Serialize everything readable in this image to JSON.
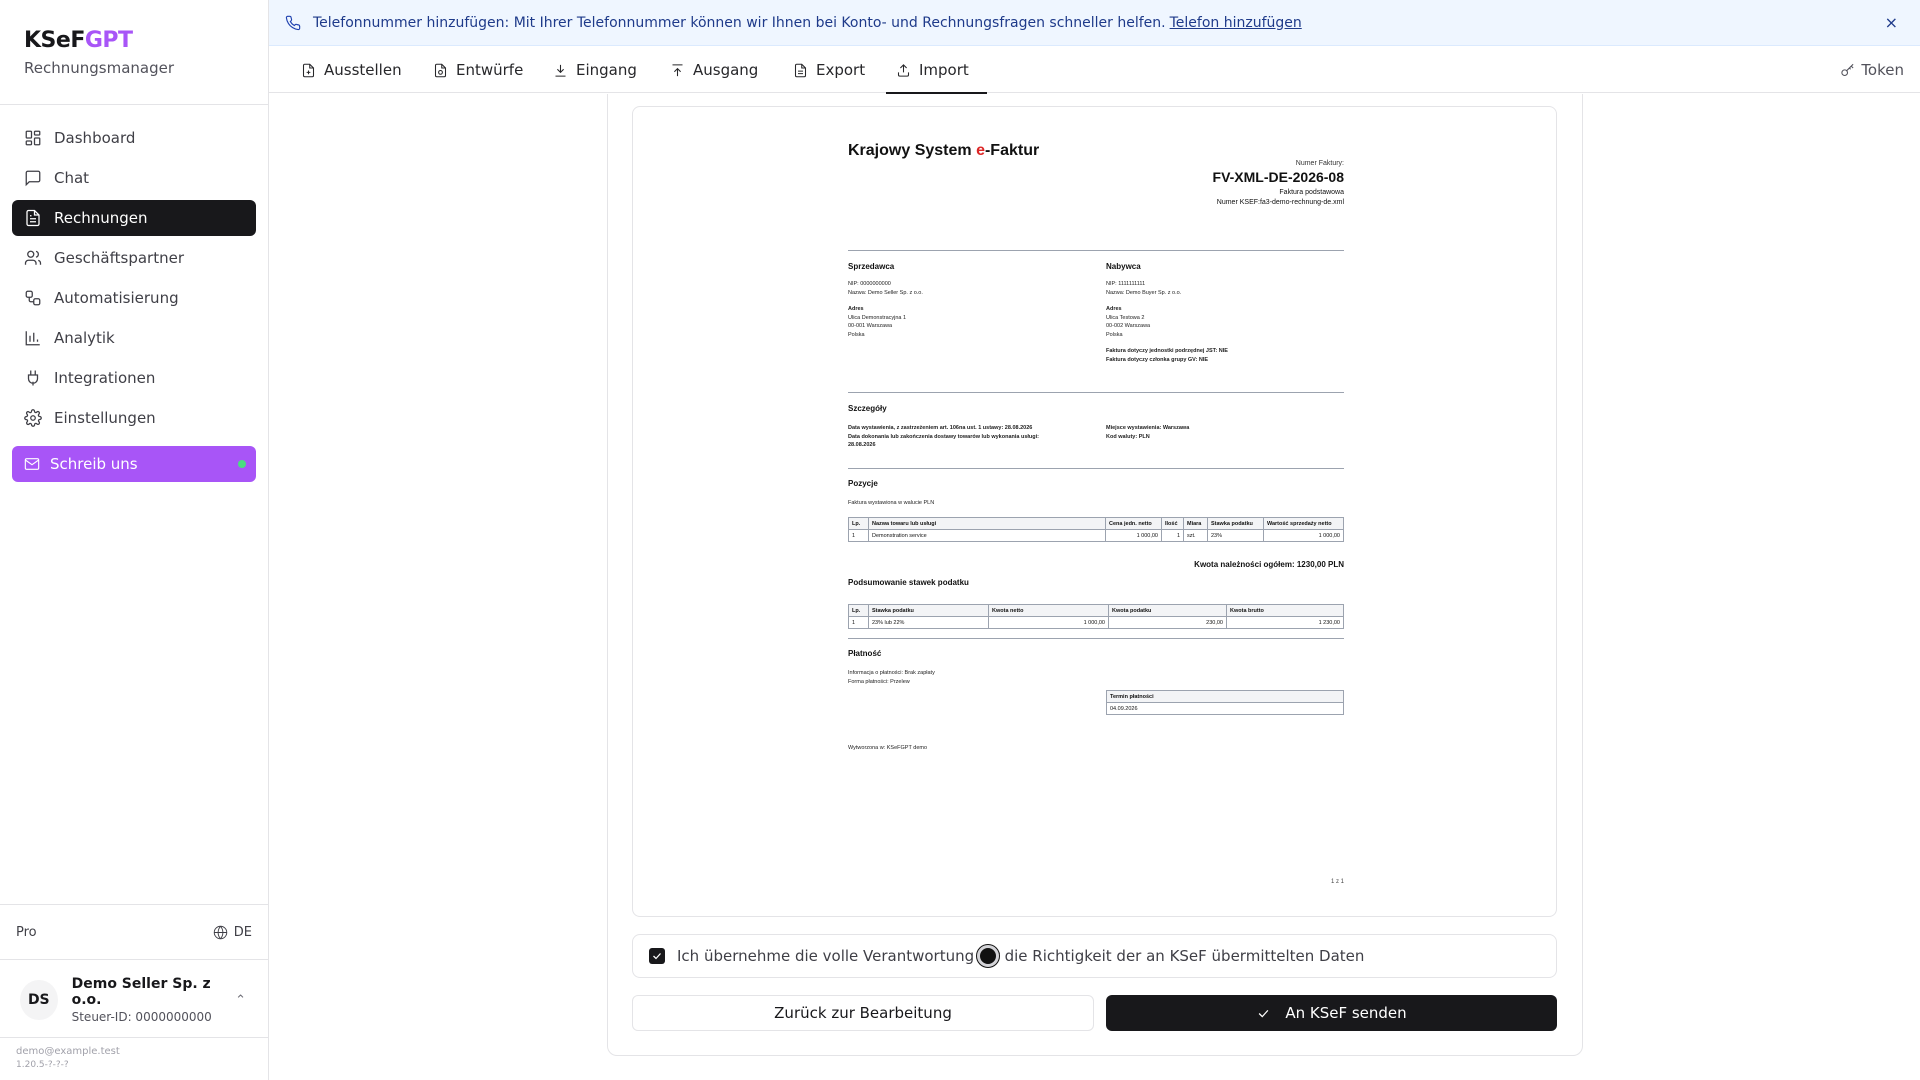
{
  "brand": {
    "name_a": "KSeF",
    "name_b": "GPT",
    "subtitle": "Rechnungsmanager",
    "accent": "#a855f7"
  },
  "sidebar": {
    "items": [
      {
        "label": "Dashboard",
        "icon": "dashboard-icon"
      },
      {
        "label": "Chat",
        "icon": "chat-icon"
      },
      {
        "label": "Rechnungen",
        "icon": "invoice-icon",
        "active": true
      },
      {
        "label": "Geschäftspartner",
        "icon": "users-icon"
      },
      {
        "label": "Automatisierung",
        "icon": "workflow-icon"
      },
      {
        "label": "Analytik",
        "icon": "bar-chart-icon"
      },
      {
        "label": "Integrationen",
        "icon": "plug-icon"
      },
      {
        "label": "Einstellungen",
        "icon": "gear-icon"
      }
    ],
    "cta": {
      "label": "Schreib uns",
      "icon": "mail-icon"
    },
    "plan": "Pro",
    "language": "DE",
    "account": {
      "initials": "DS",
      "name": "Demo Seller Sp. z o.o.",
      "tax_id": "Steuer-ID: 0000000000"
    },
    "email": "demo@example.test",
    "version": "1.20.5-?-?-?"
  },
  "banner": {
    "text": "Telefonnummer hinzufügen: Mit Ihrer Telefonnummer können wir Ihnen bei Konto- und Rechnungsfragen schneller helfen.",
    "link": "Telefon hinzufügen",
    "close": "×"
  },
  "tabs": [
    {
      "label": "Ausstellen",
      "icon": "file-plus-icon"
    },
    {
      "label": "Entwürfe",
      "icon": "draft-icon"
    },
    {
      "label": "Eingang",
      "icon": "download-icon"
    },
    {
      "label": "Ausgang",
      "icon": "upload-icon"
    },
    {
      "label": "Export",
      "icon": "file-icon"
    },
    {
      "label": "Import",
      "icon": "upload-icon",
      "active": true
    }
  ],
  "token": {
    "label": "Token",
    "icon": "key-icon"
  },
  "invoice": {
    "title_a": "Krajowy System ",
    "title_e": "e",
    "title_b": "-Faktur",
    "number_label": "Numer Faktury:",
    "number": "FV-XML-DE-2026-08",
    "type": "Faktura podstawowa",
    "ksef": "Numer KSEF:fa3-demo-rechnung-de.xml",
    "seller": {
      "title": "Sprzedawca",
      "nip": "NIP: 0000000000",
      "name": "Nazwa: Demo Seller Sp. z o.o.",
      "addr_label": "Adres",
      "addr1": "Ulica Demonstracyjna 1",
      "addr2": "00-001 Warszawa",
      "addr3": "Polska"
    },
    "buyer": {
      "title": "Nabywca",
      "nip": "NIP: 1111111111",
      "name": "Nazwa: Demo Buyer Sp. z o.o.",
      "addr_label": "Adres",
      "addr1": "Ulica Testowa 2",
      "addr2": "00-002 Warszawa",
      "addr3": "Polska",
      "jst": "Faktura dotyczy jednostki podrzędnej JST: NIE",
      "gv": "Faktura dotyczy członka grupy GV: NIE"
    },
    "details": {
      "title": "Szczegóły",
      "issue_date": "Data wystawienia, z zastrzeżeniem art. 106na ust. 1 ustawy: 28.08.2026",
      "delivery_date_a": "Data dokonania lub zakończenia dostawy towarów lub wykonania usługi:",
      "delivery_date_b": "28.08.2026",
      "place": "Miejsce wystawienia: Warszawa",
      "currency": "Kod waluty: PLN"
    },
    "items": {
      "title": "Pozycje",
      "note": "Faktura wystawiona w walucie PLN",
      "headers": [
        "Lp.",
        "Nazwa towaru lub usługi",
        "Cena jedn. netto",
        "Ilość",
        "Miara",
        "Stawka podatku",
        "Wartość sprzedaży netto"
      ],
      "rows": [
        [
          "1",
          "Demonstration service",
          "1 000,00",
          "1",
          "szt.",
          "23%",
          "1 000,00"
        ]
      ],
      "total": "Kwota należności ogółem: 1230,00 PLN"
    },
    "tax_summary": {
      "title": "Podsumowanie stawek podatku",
      "headers": [
        "Lp.",
        "Stawka podatku",
        "Kwota netto",
        "Kwota podatku",
        "Kwota brutto"
      ],
      "rows": [
        [
          "1",
          "23% lub 22%",
          "1 000,00",
          "230,00",
          "1 230,00"
        ]
      ]
    },
    "payment": {
      "title": "Płatność",
      "info": "Informacja o płatności: Brak zapłaty",
      "form": "Forma płatności: Przelew",
      "due_header": "Termin płatności",
      "due_date": "04.09.2026"
    },
    "generated_by": "Wytworzona w: KSeFGPT demo",
    "page": "1 z 1"
  },
  "confirm": {
    "text": "Ich übernehme die volle Verantwortung für die Richtigkeit der an KSeF übermittelten Daten",
    "checked": true
  },
  "buttons": {
    "back": "Zurück zur Bearbeitung",
    "send": "An KSeF senden"
  }
}
